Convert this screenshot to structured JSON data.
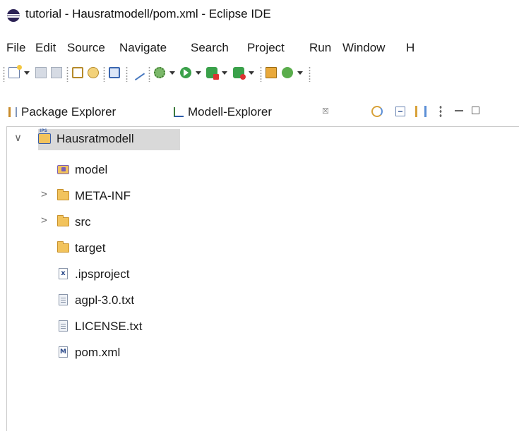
{
  "window": {
    "title": "tutorial - Hausratmodell/pom.xml - Eclipse IDE"
  },
  "menubar": {
    "items": [
      "File",
      "Edit",
      "Source",
      "Navigate",
      "Search",
      "Project",
      "Run",
      "Window",
      "H"
    ]
  },
  "toolbar": {
    "icons": [
      "new-wizard-icon",
      "save-icon",
      "save-all-icon",
      "open-type-icon",
      "open-resource-icon",
      "console-icon",
      "toggle-breakpoint-icon",
      "debug-icon",
      "run-icon",
      "coverage-icon",
      "external-tools-icon",
      "new-package-icon",
      "new-class-icon"
    ]
  },
  "views": {
    "tabs": [
      {
        "label": "Package Explorer",
        "active": false
      },
      {
        "label": "Modell-Explorer",
        "active": true,
        "close": "☒"
      }
    ]
  },
  "tree": {
    "root": {
      "label": "Hausratmodell",
      "expanded": true,
      "twistie": "∨",
      "selected": true
    },
    "children": [
      {
        "label": "model",
        "icon": "model-folder-icon",
        "expandable": false
      },
      {
        "label": "META-INF",
        "icon": "folder-icon",
        "expandable": true,
        "twistie": ">"
      },
      {
        "label": "src",
        "icon": "folder-icon",
        "expandable": true,
        "twistie": ">"
      },
      {
        "label": "target",
        "icon": "folder-icon",
        "expandable": false
      },
      {
        "label": ".ipsproject",
        "icon": "ipsproject-file-icon",
        "expandable": false
      },
      {
        "label": "agpl-3.0.txt",
        "icon": "text-file-icon",
        "expandable": false
      },
      {
        "label": "LICENSE.txt",
        "icon": "text-file-icon",
        "expandable": false
      },
      {
        "label": "pom.xml",
        "icon": "maven-pom-icon",
        "expandable": false
      }
    ]
  },
  "colors": {
    "selection": "#d9d9d9",
    "folder": "#f2c35c",
    "panel_border": "#c9c9c9"
  }
}
